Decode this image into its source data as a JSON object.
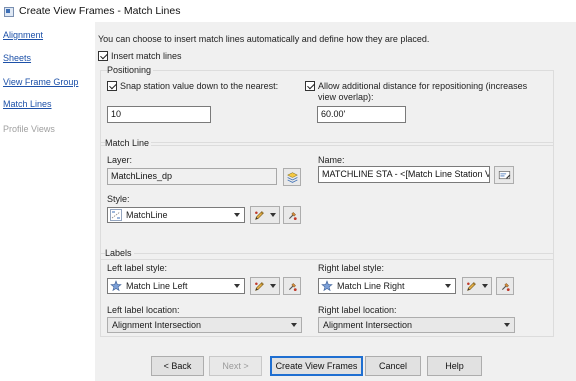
{
  "window": {
    "title": "Create View Frames - Match Lines"
  },
  "nav": {
    "items": [
      {
        "label": "Alignment",
        "enabled": true
      },
      {
        "label": "Sheets",
        "enabled": true
      },
      {
        "label": "View Frame Group",
        "enabled": true
      },
      {
        "label": "Match Lines",
        "enabled": true
      },
      {
        "label": "Profile Views",
        "enabled": false
      }
    ]
  },
  "intro_text": "You can choose to insert match lines automatically and define how they are placed.",
  "insert_match_lines": {
    "label": "Insert match lines",
    "checked": true
  },
  "positioning": {
    "legend": "Positioning",
    "snap": {
      "label": "Snap station value down to the nearest:",
      "checked": true,
      "value": "10"
    },
    "allow": {
      "label_line1": "Allow additional distance for repositioning (increases",
      "label_line2": "view overlap):",
      "checked": true,
      "value": "60.00'"
    }
  },
  "match_line": {
    "legend": "Match Line",
    "layer_label": "Layer:",
    "layer_value": "MatchLines_dp",
    "name_label": "Name:",
    "name_value": "MATCHLINE STA - <[Match Line Station Va",
    "style_label": "Style:",
    "style_value": "MatchLine"
  },
  "labels": {
    "legend": "Labels",
    "left_style_label": "Left label style:",
    "left_style_value": "Match Line Left",
    "right_style_label": "Right label style:",
    "right_style_value": "Match Line Right",
    "left_location_label": "Left label location:",
    "left_location_value": "Alignment Intersection",
    "right_location_label": "Right label location:",
    "right_location_value": "Alignment Intersection"
  },
  "buttons": {
    "back": "< Back",
    "next": "Next >",
    "create": "Create View Frames",
    "cancel": "Cancel",
    "help": "Help"
  }
}
